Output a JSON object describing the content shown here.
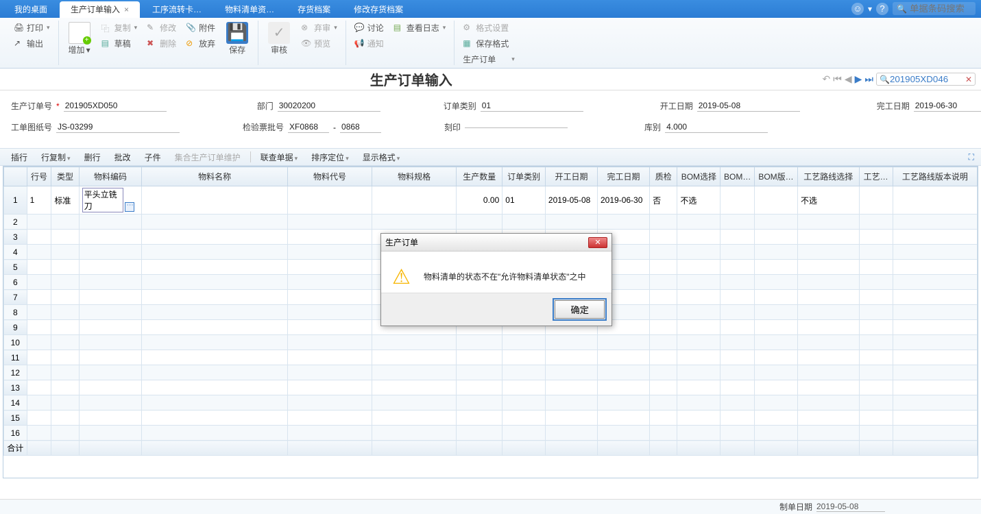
{
  "tabs": {
    "items": [
      {
        "label": "我的桌面"
      },
      {
        "label": "生产订单输入"
      },
      {
        "label": "工序流转卡…"
      },
      {
        "label": "物料清单资…"
      },
      {
        "label": "存货档案"
      },
      {
        "label": "修改存货档案"
      }
    ],
    "active_index": 1,
    "search_placeholder": "单据条码搜索"
  },
  "ribbon": {
    "print": "打印",
    "export": "输出",
    "add": "增加",
    "copy": "复制",
    "edit": "修改",
    "draft": "草稿",
    "delete": "删除",
    "attach": "附件",
    "abandon": "放弃",
    "save": "保存",
    "audit": "审核",
    "reject": "弃审",
    "preview": "预览",
    "notify": "通知",
    "discuss": "讨论",
    "log": "查看日志",
    "format": "格式设置",
    "savefmt": "保存格式",
    "doctype": "生产订单"
  },
  "title": "生产订单输入",
  "nav_search_value": "201905XD046",
  "form": {
    "order_no_label": "生产订单号",
    "order_no": "201905XD050",
    "dept_label": "部门",
    "dept": "30020200",
    "cat_label": "订单类别",
    "cat": "01",
    "start_label": "开工日期",
    "start": "2019-05-08",
    "end_label": "完工日期",
    "end": "2019-06-30",
    "drawno_label": "工单图纸号",
    "drawno": "JS-03299",
    "batch_label": "检验票批号",
    "batch_a": "XF0868",
    "batch_sep": "-",
    "batch_b": "0868",
    "stamp_label": "刻印",
    "stamp": "",
    "store_label": "库别",
    "store": "4.000"
  },
  "grid_toolbar": {
    "insert": "插行",
    "copyrow": "行复制",
    "delrow": "删行",
    "batch": "批改",
    "child": "子件",
    "agg": "集合生产订单维护",
    "link": "联查单据",
    "sort": "排序定位",
    "dispfmt": "显示格式"
  },
  "grid": {
    "headers": [
      "行号",
      "类型",
      "物料编码",
      "物料名称",
      "物料代号",
      "物料规格",
      "生产数量",
      "订单类别",
      "开工日期",
      "完工日期",
      "质检",
      "BOM选择",
      "BOM…",
      "BOM版…",
      "工艺路线选择",
      "工艺…",
      "工艺路线版本说明"
    ],
    "widths": [
      32,
      36,
      82,
      190,
      110,
      110,
      60,
      56,
      68,
      68,
      36,
      56,
      40,
      46,
      80,
      44,
      110
    ],
    "row1": {
      "rowno": "1",
      "type": "标准",
      "matcode": "平头立铣刀",
      "qty": "0.00",
      "cat": "01",
      "start": "2019-05-08",
      "end": "2019-06-30",
      "qc": "否",
      "bomsel": "不选",
      "routesel": "不选"
    },
    "sum_label": "合计"
  },
  "modal": {
    "title": "生产订单",
    "message": "物料清单的状态不在\"允许物料清单状态\"之中",
    "ok": "确定"
  },
  "status": {
    "label": "制单日期",
    "value": "2019-05-08"
  }
}
